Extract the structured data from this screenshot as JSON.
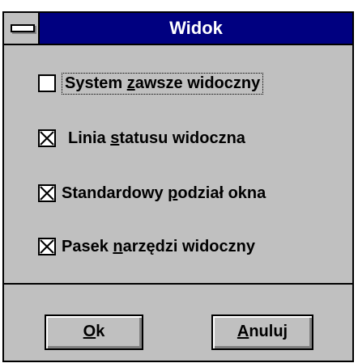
{
  "window": {
    "title": "Widok"
  },
  "options": [
    {
      "before": "System ",
      "accel": "z",
      "after": "awsze widoczny",
      "checked": false,
      "focused": true
    },
    {
      "before": "Linia ",
      "accel": "s",
      "after": "tatusu widoczna",
      "checked": true,
      "focused": false
    },
    {
      "before": "Standardowy ",
      "accel": "p",
      "after": "odział okna",
      "checked": true,
      "focused": false
    },
    {
      "before": "Pasek ",
      "accel": "n",
      "after": "arzędzi widoczny",
      "checked": true,
      "focused": false
    }
  ],
  "buttons": {
    "ok": {
      "accel": "O",
      "rest": "k"
    },
    "cancel": {
      "accel": "A",
      "rest": "nuluj"
    }
  },
  "colors": {
    "titlebar": "#000080",
    "face": "#c0c0c0"
  }
}
